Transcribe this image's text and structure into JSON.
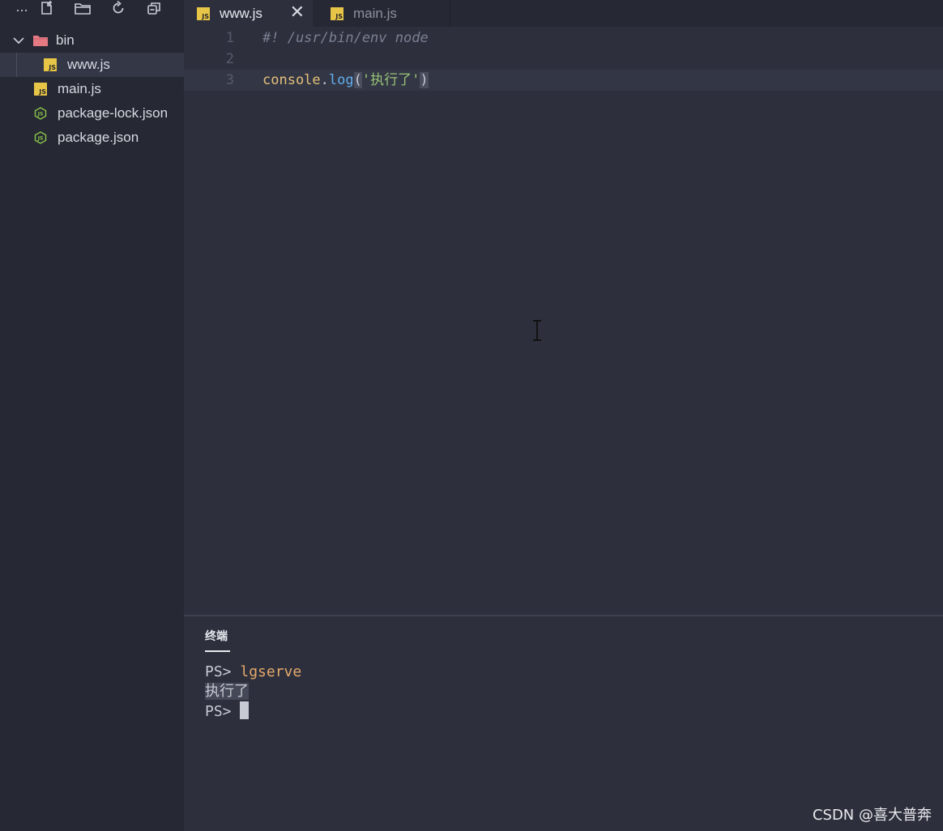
{
  "toolbar": {
    "more_label": "...",
    "new_file_icon": "new-file-icon",
    "new_folder_icon": "new-folder-icon",
    "refresh_icon": "refresh-icon",
    "collapse_icon": "collapse-all-icon"
  },
  "tree": {
    "folder": {
      "label": "bin",
      "expanded": true
    },
    "items": [
      {
        "label": "www.js",
        "type": "js",
        "selected": true
      },
      {
        "label": "main.js",
        "type": "js"
      },
      {
        "label": "package-lock.json",
        "type": "node"
      },
      {
        "label": "package.json",
        "type": "node"
      }
    ]
  },
  "tabs": [
    {
      "label": "www.js",
      "active": true,
      "close": "✕"
    },
    {
      "label": "main.js",
      "active": false
    }
  ],
  "js_badge": "JS",
  "editor": {
    "lines": [
      {
        "number": "1",
        "comment": "#! /usr/bin/env node"
      },
      {
        "number": "2"
      },
      {
        "number": "3",
        "obj": "console",
        "dot": ".",
        "fn": "log",
        "open": "(",
        "str": "'执行了'",
        "close": ")"
      }
    ]
  },
  "terminal": {
    "title": "终端",
    "lines": [
      {
        "prompt": "PS> ",
        "command": "lgserve"
      },
      {
        "output": "执行了"
      },
      {
        "prompt": "PS> "
      }
    ]
  },
  "watermark": "CSDN @喜大普奔",
  "colors": {
    "background": "#2d303c",
    "sidebar": "#262833",
    "js_badge": "#e7c547",
    "node_icon": "#8cc84b",
    "folder_icon": "#e57a83"
  }
}
